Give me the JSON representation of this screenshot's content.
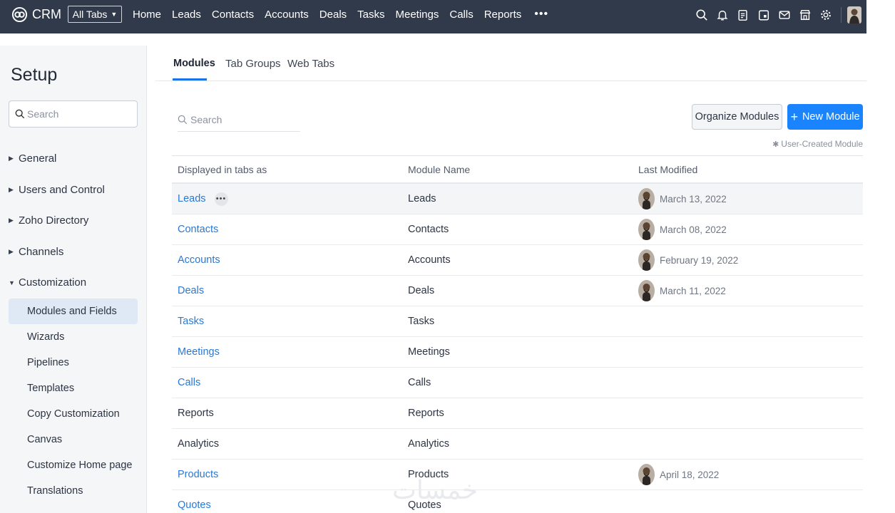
{
  "topbar": {
    "brand": "CRM",
    "all_tabs": "All Tabs",
    "tabs": [
      "Home",
      "Leads",
      "Contacts",
      "Accounts",
      "Deals",
      "Tasks",
      "Meetings",
      "Calls",
      "Reports"
    ],
    "more": "•••",
    "icons": [
      "search-icon",
      "bell-icon",
      "signals-icon",
      "calendar-icon",
      "mail-icon",
      "marketplace-icon",
      "gear-icon"
    ]
  },
  "sidebar": {
    "title": "Setup",
    "search_placeholder": "Search",
    "sections": [
      {
        "label": "General",
        "expanded": false
      },
      {
        "label": "Users and Control",
        "expanded": false
      },
      {
        "label": "Zoho Directory",
        "expanded": false
      },
      {
        "label": "Channels",
        "expanded": false
      },
      {
        "label": "Customization",
        "expanded": true
      }
    ],
    "customization_items": [
      "Modules and Fields",
      "Wizards",
      "Pipelines",
      "Templates",
      "Copy Customization",
      "Canvas",
      "Customize Home page",
      "Translations"
    ],
    "active_item": "Modules and Fields"
  },
  "main": {
    "tabs": [
      "Modules",
      "Tab Groups",
      "Web Tabs"
    ],
    "active_tab": "Modules",
    "search_placeholder": "Search",
    "organize_label": "Organize Modules",
    "new_module_label": "New Module",
    "user_created_note": "User-Created Module",
    "columns": [
      "Displayed in tabs as",
      "Module Name",
      "Last Modified"
    ],
    "rows": [
      {
        "display": "Leads",
        "module": "Leads",
        "modified": "March 13, 2022",
        "link": true,
        "has_avatar": true
      },
      {
        "display": "Contacts",
        "module": "Contacts",
        "modified": "March 08, 2022",
        "link": true,
        "has_avatar": true
      },
      {
        "display": "Accounts",
        "module": "Accounts",
        "modified": "February 19, 2022",
        "link": true,
        "has_avatar": true
      },
      {
        "display": "Deals",
        "module": "Deals",
        "modified": "March 11, 2022",
        "link": true,
        "has_avatar": true
      },
      {
        "display": "Tasks",
        "module": "Tasks",
        "modified": "",
        "link": true,
        "has_avatar": false
      },
      {
        "display": "Meetings",
        "module": "Meetings",
        "modified": "",
        "link": true,
        "has_avatar": false
      },
      {
        "display": "Calls",
        "module": "Calls",
        "modified": "",
        "link": true,
        "has_avatar": false
      },
      {
        "display": "Reports",
        "module": "Reports",
        "modified": "",
        "link": false,
        "has_avatar": false
      },
      {
        "display": "Analytics",
        "module": "Analytics",
        "modified": "",
        "link": false,
        "has_avatar": false
      },
      {
        "display": "Products",
        "module": "Products",
        "modified": "April 18, 2022",
        "link": true,
        "has_avatar": true
      },
      {
        "display": "Quotes",
        "module": "Quotes",
        "modified": "",
        "link": true,
        "has_avatar": false
      }
    ]
  },
  "colors": {
    "topbar": "#313a4b",
    "link": "#2a78d4",
    "primary_button": "#1a84ff",
    "active_nav": "#dfe8f5"
  },
  "watermark": "خمسات"
}
